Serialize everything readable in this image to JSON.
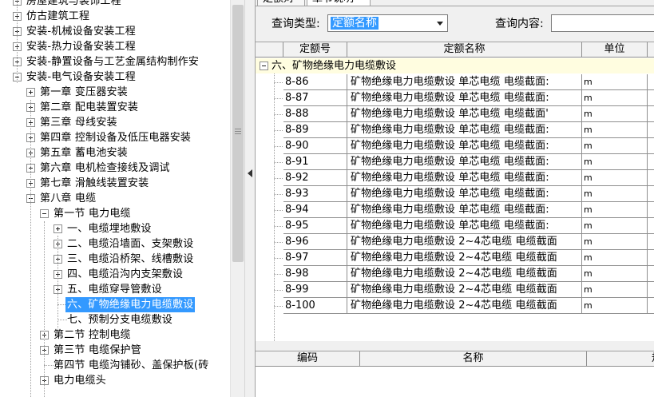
{
  "tree": {
    "nodes": [
      {
        "label": "房屋建筑与装饰工程",
        "toggle": "plus"
      },
      {
        "label": "仿古建筑工程",
        "toggle": "plus"
      },
      {
        "label": "安装-机械设备安装工程",
        "toggle": "plus"
      },
      {
        "label": "安装-热力设备安装工程",
        "toggle": "plus"
      },
      {
        "label": "安装-静置设备与工艺金属结构制作安",
        "toggle": "plus"
      },
      {
        "label": "安装-电气设备安装工程",
        "toggle": "minus"
      },
      {
        "label": "第一章  变压器安装",
        "toggle": "plus"
      },
      {
        "label": "第二章  配电装置安装",
        "toggle": "plus"
      },
      {
        "label": "第三章  母线安装",
        "toggle": "plus"
      },
      {
        "label": "第四章  控制设备及低压电器安装",
        "toggle": "plus"
      },
      {
        "label": "第五章  蓄电池安装",
        "toggle": "plus"
      },
      {
        "label": "第六章  电机检查接线及调试",
        "toggle": "plus"
      },
      {
        "label": "第七章  滑触线装置安装",
        "toggle": "plus"
      },
      {
        "label": "第八章  电缆",
        "toggle": "minus"
      },
      {
        "label": "第一节  电力电缆",
        "toggle": "minus"
      },
      {
        "label": "一、电缆埋地敷设",
        "toggle": "plus"
      },
      {
        "label": "二、电缆沿墙面、支架敷设",
        "toggle": "plus"
      },
      {
        "label": "三、电缆沿桥架、线槽敷设",
        "toggle": "plus"
      },
      {
        "label": "四、电缆沿沟内支架敷设",
        "toggle": "plus"
      },
      {
        "label": "五、电缆穿导管敷设",
        "toggle": "plus"
      },
      {
        "label": "六、矿物绝缘电力电缆敷设",
        "toggle": "none"
      },
      {
        "label": "七、预制分支电缆敷设",
        "toggle": "none"
      },
      {
        "label": "第二节  控制电缆",
        "toggle": "plus"
      },
      {
        "label": "第三节  电缆保护管",
        "toggle": "plus"
      },
      {
        "label": "第四节  电缆沟铺砂、盖保护板(砖",
        "toggle": "none"
      },
      {
        "label": "电力电缆头",
        "toggle": "plus"
      }
    ],
    "selected_label": "六、矿物绝缘电力电缆敷设"
  },
  "tabs": {
    "tab1": "定额对照",
    "tab2": "章节说明"
  },
  "query": {
    "type_label": "查询类型:",
    "type_value": "定额名称",
    "content_label": "查询内容:",
    "content_value": ""
  },
  "grid": {
    "headers": [
      "定额号",
      "定额名称",
      "单位"
    ],
    "group_title": "六、矿物绝缘电力电缆敷设",
    "rows": [
      {
        "code": "8-86",
        "name": "矿物绝缘电力电缆敷设 单芯电缆 电缆截面:",
        "unit": "m"
      },
      {
        "code": "8-87",
        "name": "矿物绝缘电力电缆敷设 单芯电缆 电缆截面:",
        "unit": "m"
      },
      {
        "code": "8-88",
        "name": "矿物绝缘电力电缆敷设 单芯电缆 电缆截面'",
        "unit": "m"
      },
      {
        "code": "8-89",
        "name": "矿物绝缘电力电缆敷设 单芯电缆 电缆截面:",
        "unit": "m"
      },
      {
        "code": "8-90",
        "name": "矿物绝缘电力电缆敷设 单芯电缆 电缆截面:",
        "unit": "m"
      },
      {
        "code": "8-91",
        "name": "矿物绝缘电力电缆敷设 单芯电缆 电缆截面:",
        "unit": "m"
      },
      {
        "code": "8-92",
        "name": "矿物绝缘电力电缆敷设 单芯电缆 电缆截面:",
        "unit": "m"
      },
      {
        "code": "8-93",
        "name": "矿物绝缘电力电缆敷设 单芯电缆 电缆截面:",
        "unit": "m"
      },
      {
        "code": "8-94",
        "name": "矿物绝缘电力电缆敷设 单芯电缆 电缆截面:",
        "unit": "m"
      },
      {
        "code": "8-95",
        "name": "矿物绝缘电力电缆敷设 单芯电缆 电缆截面:",
        "unit": "m"
      },
      {
        "code": "8-96",
        "name": "矿物绝缘电力电缆敷设 2~4芯电缆 电缆截面",
        "unit": "m"
      },
      {
        "code": "8-97",
        "name": "矿物绝缘电力电缆敷设 2~4芯电缆 电缆截面",
        "unit": "m"
      },
      {
        "code": "8-98",
        "name": "矿物绝缘电力电缆敷设 2~4芯电缆 电缆截面",
        "unit": "m"
      },
      {
        "code": "8-99",
        "name": "矿物绝缘电力电缆敷设 2~4芯电缆 电缆截面",
        "unit": "m"
      },
      {
        "code": "8-100",
        "name": "矿物绝缘电力电缆敷设 2~4芯电缆 电缆截面",
        "unit": "m"
      }
    ]
  },
  "detail_grid": {
    "headers": [
      "编码",
      "名称",
      "规"
    ]
  }
}
